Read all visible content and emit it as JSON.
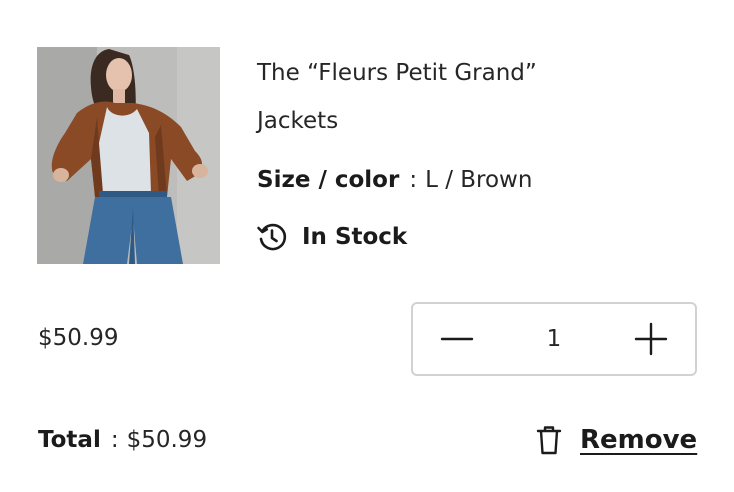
{
  "product": {
    "title": "The “Fleurs Petit Grand”",
    "category": "Jackets",
    "variant_label": "Size / color",
    "variant_separator": ":",
    "variant_value": "L / Brown",
    "stock_status": "In Stock",
    "stock_icon": "clock-history-icon",
    "image_alt": "Woman wearing brown leather jacket, white top and blue jeans"
  },
  "price": "$50.99",
  "quantity": {
    "value": "1",
    "decrement_icon": "minus-icon",
    "increment_icon": "plus-icon"
  },
  "total": {
    "label": "Total",
    "separator": ":",
    "value": "$50.99"
  },
  "remove": {
    "label": "Remove",
    "icon": "trash-icon"
  },
  "colors": {
    "text": "#1b1b1b",
    "border": "#d2d2d2",
    "jacket": "#8a4a26",
    "jeans": "#3f6f9e"
  }
}
